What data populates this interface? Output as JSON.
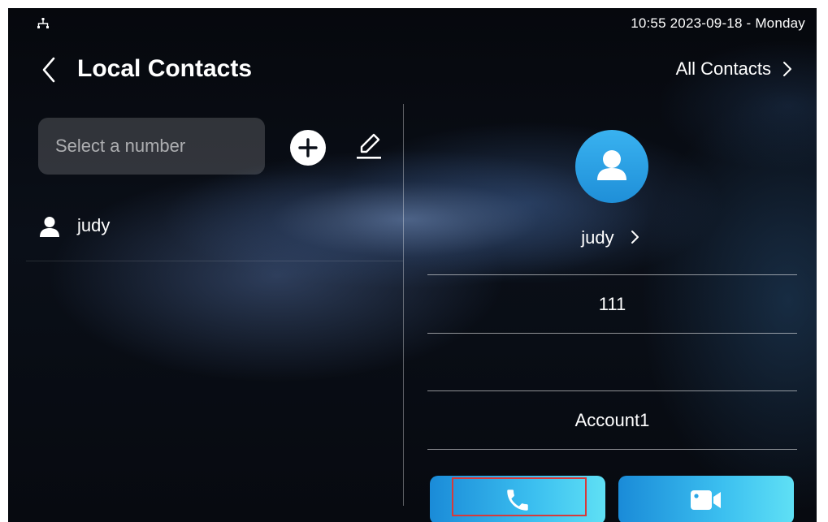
{
  "status_bar": {
    "clock": "10:55  2023-09-18 - Monday",
    "network_icon": "network-icon"
  },
  "header": {
    "title": "Local Contacts",
    "all_contacts_label": "All Contacts",
    "back_icon": "chevron-left-icon",
    "forward_icon": "chevron-right-icon"
  },
  "search": {
    "placeholder": "Select a number",
    "value": ""
  },
  "toolbar": {
    "add_icon": "plus-circle-icon",
    "edit_icon": "pencil-icon"
  },
  "contacts": [
    {
      "name": "judy",
      "icon": "person-icon"
    }
  ],
  "detail": {
    "avatar_icon": "person-icon",
    "name": "judy",
    "number": "111",
    "empty_field": "",
    "account": "Account1"
  },
  "actions": {
    "audio_call_icon": "phone-icon",
    "video_call_icon": "video-camera-icon"
  },
  "colors": {
    "accent": "#1f8fd8",
    "button_gradient_end": "#5fe0f5",
    "highlight": "#d63a3a"
  }
}
